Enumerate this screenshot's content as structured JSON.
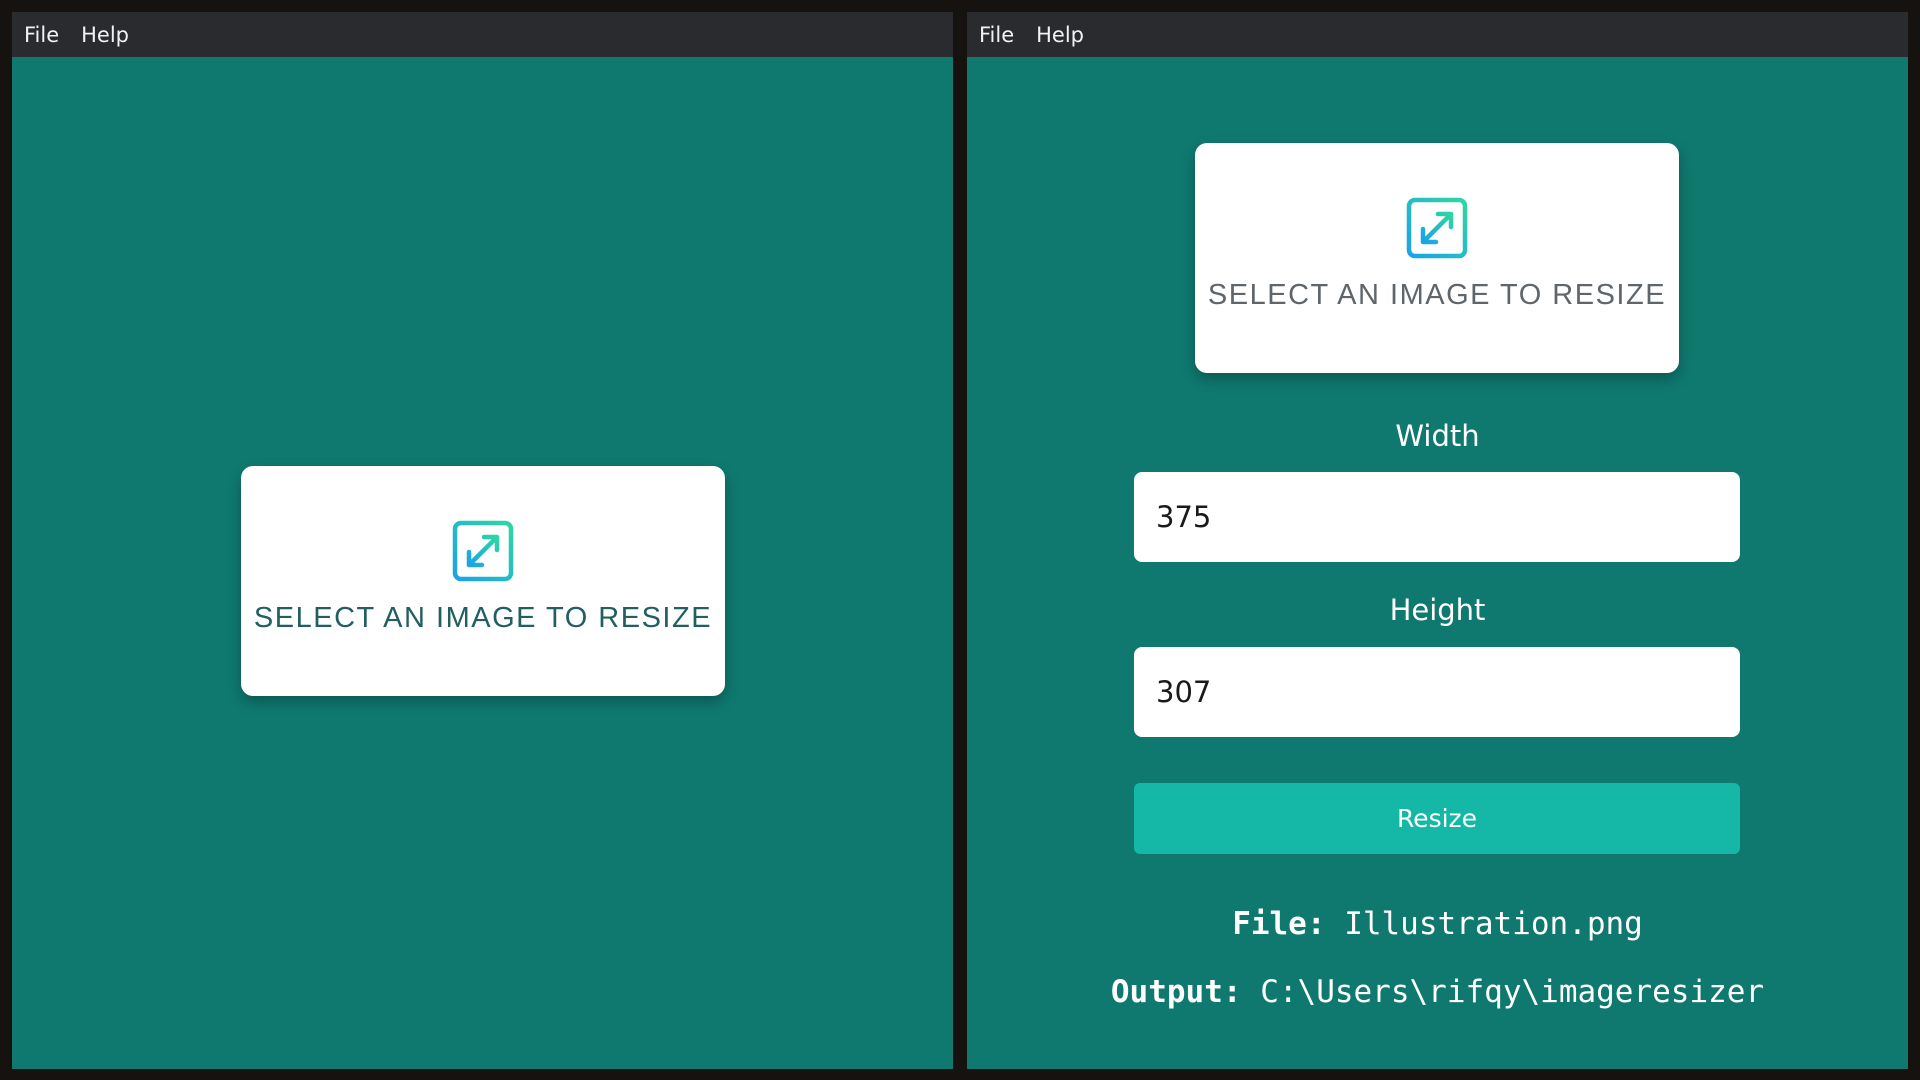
{
  "left_window": {
    "menu": [
      "File",
      "Help"
    ],
    "select_card": {
      "icon": "resize-arrows-icon",
      "label": "SELECT AN IMAGE TO RESIZE"
    }
  },
  "right_window": {
    "menu": [
      "File",
      "Help"
    ],
    "select_card": {
      "icon": "resize-arrows-icon",
      "label": "SELECT AN IMAGE TO RESIZE"
    },
    "width": {
      "label": "Width",
      "value": "375"
    },
    "height": {
      "label": "Height",
      "value": "307"
    },
    "resize_button": "Resize",
    "file": {
      "label": "File:",
      "value": "Illustration.png"
    },
    "output": {
      "label": "Output:",
      "value": "C:\\Users\\rifqy\\imageresizer"
    }
  },
  "colors": {
    "background": "#0f7970",
    "menubar": "#2a2b2e",
    "accent": "#15b8a6",
    "icon_gradient_start": "#2fd6a3",
    "icon_gradient_end": "#1aa3e8"
  }
}
